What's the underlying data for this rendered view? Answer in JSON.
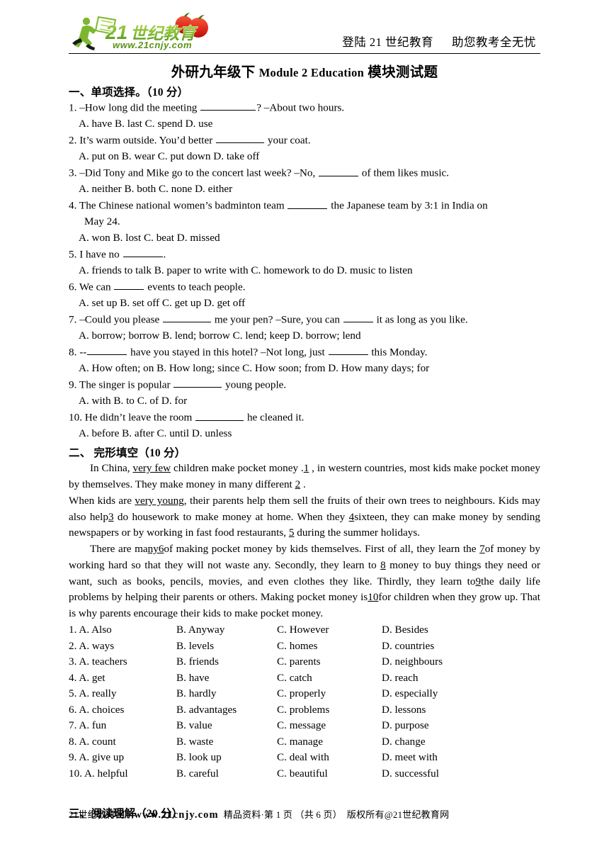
{
  "header": {
    "logo": {
      "brand_cn": "21世纪教育",
      "brand_num": "21",
      "url": "www.21cnjy.com",
      "green": "#7cb82f",
      "dark_green": "#5a9216",
      "red": "#e0261c"
    },
    "right_text_1": "登陆 21 世纪教育",
    "right_text_2": "助您教考全无忧"
  },
  "title": {
    "cn_prefix": "外研九年级下",
    "en_middle": "Module 2 Education",
    "cn_suffix": "模块测试题"
  },
  "sections": {
    "one": "一、单项选择。（10 分）",
    "two": "二、 完形填空（10 分）",
    "three": "三、阅读理解（20 分）"
  },
  "mcq": [
    {
      "stem_a": "1. –How long did the meeting ",
      "blank": "b-xl",
      "stem_b": "? –About two hours.",
      "options": "A. have        B. last        C. spend        D. use"
    },
    {
      "stem_a": "2. It’s warm outside. You’d better ",
      "blank": "b-lg",
      "stem_b": " your coat.",
      "options": "A. put on        B. wear        C. put down         D. take off"
    },
    {
      "stem_a": "3. –Did Tony and Mike go to the concert last week? –No, ",
      "blank": "b-md",
      "stem_b": " of them likes music.",
      "options": "A. neither        B. both        C. none          D. either"
    },
    {
      "stem_a": "4. The Chinese national women’s badminton team ",
      "blank": "b-md",
      "stem_b": " the Japanese team by 3:1 in India on",
      "continuation": "May 24.",
      "options": "A. won        B. lost        C. beat        D. missed"
    },
    {
      "stem_a": "5. I have no ",
      "blank": "b-md",
      "stem_b": ".",
      "options": "A. friends to talk    B. paper to write with        C. homework to do    D. music to listen"
    },
    {
      "stem_a": "6. We can ",
      "blank": "b-sm",
      "stem_b": " events to teach people.",
      "options": "A. set up        B. set off        C. get up         D. get off"
    },
    {
      "stem_a": "7. –Could you please ",
      "blank": "b-lg",
      "stem_b": " me your pen? –Sure, you can ",
      "blank2": "b-sm",
      "stem_c": " it as long as you like.",
      "options": "A. borrow; borrow        B. lend; borrow        C. lend; keep        D. borrow; lend"
    },
    {
      "stem_a": "8. --",
      "blank": "b-md",
      "stem_b": " have you stayed in this hotel? –Not long, just ",
      "blank2": "b-md",
      "stem_c": " this Monday.",
      "options": "A. How often; on        B. How long; since        C. How soon; from     D. How many days; for"
    },
    {
      "stem_a": "9. The singer is popular ",
      "blank": "b-lg",
      "stem_b": " young people.",
      "options": "A. with        B. to        C. of        D. for"
    },
    {
      "stem_a": "10. He didn’t leave the room ",
      "blank": "b-lg",
      "stem_b": " he cleaned it.",
      "options": "A. before        B. after        C. until         D. unless"
    }
  ],
  "cloze": {
    "p1_seg1": "In China, ",
    "p1_u1": "very few",
    "p1_seg2": " children make pocket money .",
    "p1_n1": "1",
    "p1_seg3": " , in western countries, most kids make pocket money by themselves. They make money in many different ",
    "p1_n2": "2",
    "p1_seg4": " .",
    "p2_seg1": "When kids are ",
    "p2_u1": "very young",
    "p2_seg2": ", their parents help them sell the fruits of their own trees to neighbours. Kids may also help",
    "p2_n3": "3",
    "p2_seg3": " do housework to make money at home. When they ",
    "p2_n4": "4",
    "p2_seg4": "sixteen, they can make money by sending newspapers or by working in fast food restaurants, ",
    "p2_n5": "5",
    "p2_seg5": " during the summer holidays.",
    "p3_seg1": "There are ma",
    "p3_u1": "ny",
    "p3_n6": "6",
    "p3_seg2": "of making pocket money by kids themselves. First of all, they learn the ",
    "p3_n7": "7",
    "p3_seg3": "of money by working hard so that they will not waste any. Secondly, they learn to ",
    "p3_n8": "8",
    "p3_seg4": " money to buy things they need or want, such as books, pencils, movies, and even clothes they like. Thirdly, they learn to",
    "p3_n9": "9",
    "p3_seg5": "the daily life problems by helping their parents or others. Making pocket money is",
    "p3_n10": "10",
    "p3_seg6": "for children when they grow up. That is why parents encourage their kids to make pocket money."
  },
  "cloze_options": [
    {
      "num": "1.",
      "a": "A. Also",
      "b": "B. Anyway",
      "c": "C. However",
      "d": "D. Besides"
    },
    {
      "num": "2.",
      "a": "A. ways",
      "b": "B. levels",
      "c": "C. homes",
      "d": "D. countries"
    },
    {
      "num": "3.",
      "a": "A. teachers",
      "b": "B. friends",
      "c": "C. parents",
      "d": "D. neighbours"
    },
    {
      "num": "4.",
      "a": "A. get",
      "b": "B. have",
      "c": "C. catch",
      "d": "D. reach"
    },
    {
      "num": "5.",
      "a": "A. really",
      "b": "B. hardly",
      "c": "C. properly",
      "d": "D. especially"
    },
    {
      "num": "6.",
      "a": "A. choices",
      "b": "B. advantages",
      "c": "C. problems",
      "d": "D. lessons"
    },
    {
      "num": "7.",
      "a": "A. fun",
      "b": "B. value",
      "c": "C. message",
      "d": "D. purpose"
    },
    {
      "num": "8.",
      "a": "A. count",
      "b": "B. waste",
      "c": "C. manage",
      "d": "D. change"
    },
    {
      "num": "9.",
      "a": "A. give up",
      "b": "B. look up",
      "c": "C. deal with",
      "d": "D. meet with"
    },
    {
      "num": "10.",
      "a": "A. helpful",
      "b": "B. careful",
      "c": "C. beautiful",
      "d": "D. successful"
    }
  ],
  "footer": {
    "site_cn": "21世纪教育网",
    "site_url": "www.21cnjy.com",
    "material": "精品资料·第 1 页 （共 6 页）",
    "copyright": "版权所有@21世纪教育网"
  }
}
